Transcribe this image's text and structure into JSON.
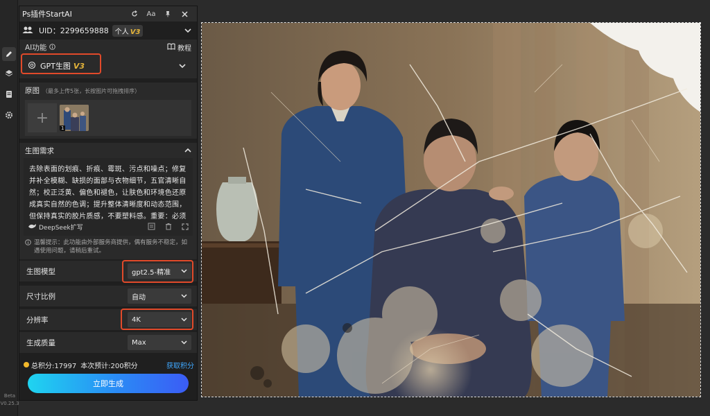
{
  "panel": {
    "title": "Ps插件StartAI",
    "uid_text": "UID：2299659888",
    "user_type": "个人",
    "user_version": "V3"
  },
  "ai": {
    "label": "AI功能",
    "tutorial": "教程",
    "function_name": "GPT生图",
    "function_version": "V3"
  },
  "original": {
    "label": "原图",
    "hint": "（最多上传5张，长按图片可拖拽排序）",
    "thumb_index": "1"
  },
  "requirement": {
    "label": "生图需求",
    "text": "去除表面的划痕、折痕、霉斑、污点和噪点；修复并补全模糊、缺损的面部与衣物细节，五官清晰自然；校正泛黄、偏色和褪色，让肤色和环境色还原成真实自然的色调；提升整体清晰度和动态范围，但保持真实的胶片质感，不要塑料感。重要：必须保持画面中每个人的长相、年龄、表",
    "deepseek": "DeepSeek扩写"
  },
  "notice": "温馨提示：此功能由外部服务商提供，偶有服务不稳定，如遇使用问题，请稍后重试。",
  "options": {
    "model_label": "生图模型",
    "model_value": "gpt2.5-精准",
    "ratio_label": "尺寸比例",
    "ratio_value": "自动",
    "resolution_label": "分辨率",
    "resolution_value": "4K",
    "quality_label": "生成质量",
    "quality_value": "Max"
  },
  "credits": {
    "total": "总积分:17997",
    "estimate": "本次预计:200积分",
    "get": "获取积分"
  },
  "generate_label": "立即生成",
  "version": {
    "beta": "Beta",
    "number": "V0.25.3"
  },
  "colors": {
    "accent": "#e24a2a",
    "version_gold": "#e4b43a",
    "link_blue": "#3fa8ff",
    "button_gradient_start": "#1fd4f0",
    "button_gradient_end": "#3b5cf5"
  }
}
